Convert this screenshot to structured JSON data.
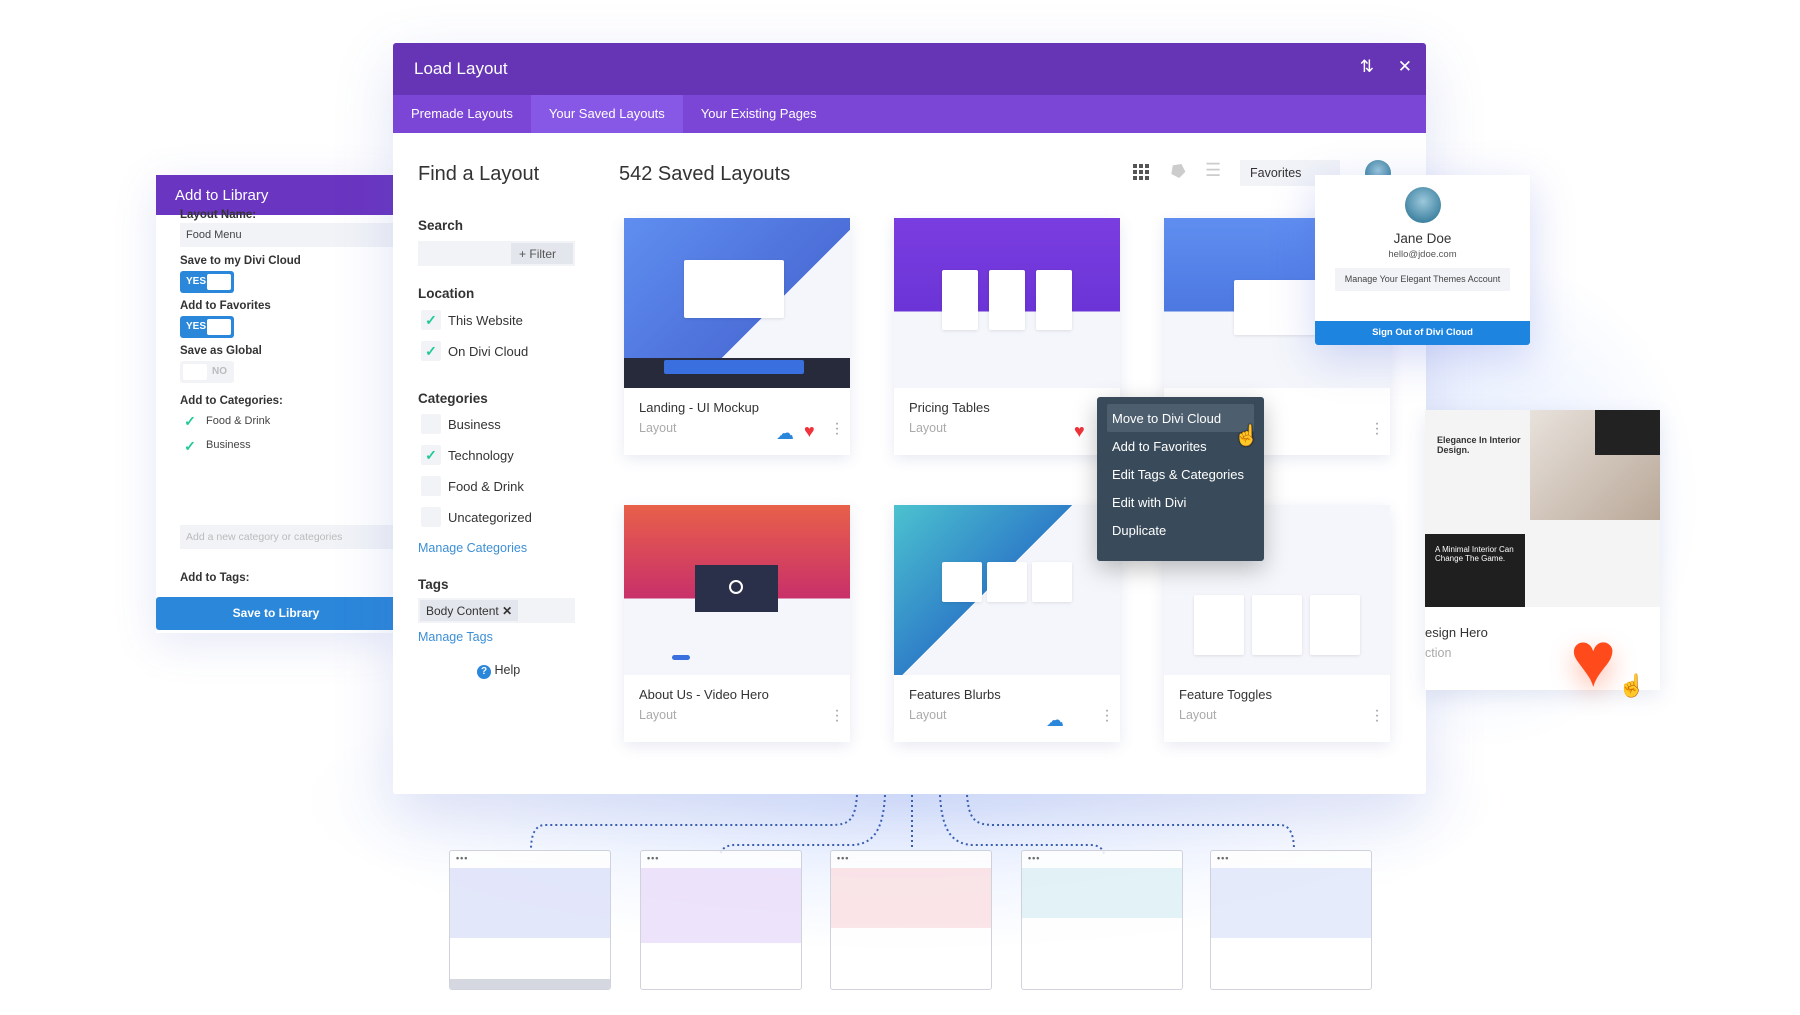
{
  "library_panel": {
    "title": "Add to Library",
    "layout_name_label": "Layout Name:",
    "layout_name_value": "Food Menu",
    "cloud_label": "Save to my Divi Cloud",
    "cloud_toggle": "YES",
    "fav_label": "Add to Favorites",
    "fav_toggle": "YES",
    "global_label": "Save as Global",
    "global_toggle": "NO",
    "categories_label": "Add to Categories:",
    "categories": [
      "Food & Drink",
      "Business"
    ],
    "category_placeholder": "Add a new category or categories",
    "tags_label": "Add to Tags:",
    "save_button": "Save to Library"
  },
  "modal": {
    "title": "Load Layout",
    "tabs": [
      "Premade Layouts",
      "Your Saved Layouts",
      "Your Existing Pages"
    ],
    "active_tab": "Your Saved Layouts"
  },
  "sidebar": {
    "title": "Find a Layout",
    "search_label": "Search",
    "filter_button": "Filter",
    "location_label": "Location",
    "locations": [
      {
        "label": "This Website",
        "checked": true
      },
      {
        "label": "On Divi Cloud",
        "checked": true
      }
    ],
    "categories_label": "Categories",
    "categories": [
      {
        "label": "Business",
        "checked": false
      },
      {
        "label": "Technology",
        "checked": true
      },
      {
        "label": "Food & Drink",
        "checked": false
      },
      {
        "label": "Uncategorized",
        "checked": false
      }
    ],
    "manage_categories": "Manage Categories",
    "tags_label": "Tags",
    "tag_chip": "Body Content",
    "manage_tags": "Manage Tags",
    "help": "Help"
  },
  "main": {
    "heading": "542 Saved Layouts",
    "filter_select": "Favorites",
    "cards": [
      {
        "title": "Landing - UI Mockup",
        "subtitle": "Layout",
        "cloud": true,
        "favorite": true
      },
      {
        "title": "Pricing Tables",
        "subtitle": "Layout",
        "cloud": false,
        "favorite": true
      },
      {
        "title": "",
        "subtitle": "",
        "cloud": false,
        "favorite": false
      },
      {
        "title": "About Us - Video Hero",
        "subtitle": "Layout",
        "cloud": false,
        "favorite": false
      },
      {
        "title": "Features Blurbs",
        "subtitle": "Layout",
        "cloud": true,
        "favorite": false
      },
      {
        "title": "Feature Toggles",
        "subtitle": "Layout",
        "cloud": false,
        "favorite": false
      }
    ]
  },
  "context_menu": [
    "Move to Divi Cloud",
    "Add to Favorites",
    "Edit Tags & Categories",
    "Edit with Divi",
    "Duplicate"
  ],
  "profile": {
    "name": "Jane Doe",
    "email": "hello@jdoe.com",
    "manage_button": "Manage Your Elegant Themes Account",
    "signout_button": "Sign Out of Divi Cloud"
  },
  "side_card": {
    "title": "esign Hero",
    "subtitle": "ction",
    "preview_heading": "Elegance In Interior Design.",
    "preview_subheading": "A Minimal Interior Can Change The Game."
  },
  "colors": {
    "purple": "#6535b5",
    "tab_purple": "#7b45d6",
    "blue": "#2b87da",
    "heart": "#ff4a1c",
    "menu": "#394b5a"
  }
}
